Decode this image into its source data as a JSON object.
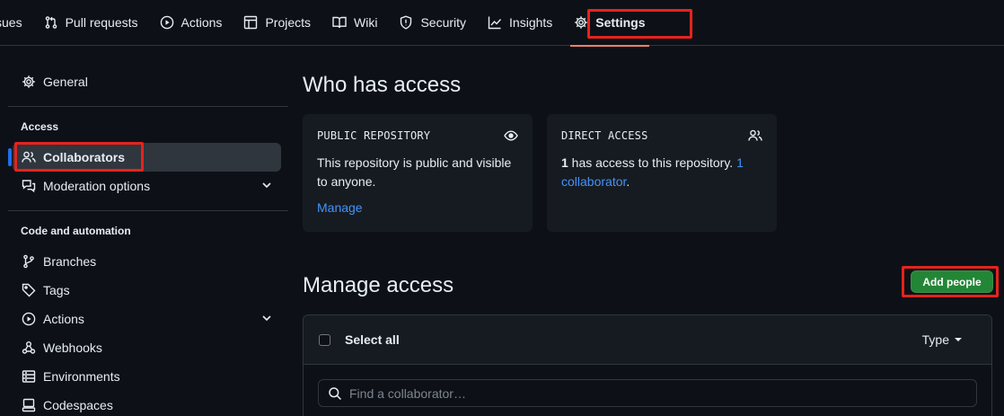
{
  "topnav": {
    "items": [
      {
        "label": "sues",
        "icon": "issue-icon"
      },
      {
        "label": "Pull requests",
        "icon": "pull-request-icon"
      },
      {
        "label": "Actions",
        "icon": "play-icon"
      },
      {
        "label": "Projects",
        "icon": "table-icon"
      },
      {
        "label": "Wiki",
        "icon": "book-icon"
      },
      {
        "label": "Security",
        "icon": "shield-icon"
      },
      {
        "label": "Insights",
        "icon": "graph-icon"
      },
      {
        "label": "Settings",
        "icon": "gear-icon",
        "selected": true
      }
    ]
  },
  "sidebar": {
    "general": "General",
    "access_heading": "Access",
    "collaborators": "Collaborators",
    "moderation": "Moderation options",
    "code_heading": "Code and automation",
    "branches": "Branches",
    "tags": "Tags",
    "actions": "Actions",
    "webhooks": "Webhooks",
    "environments": "Environments",
    "codespaces": "Codespaces"
  },
  "main": {
    "who_title": "Who has access",
    "public_card": {
      "label": "PUBLIC REPOSITORY",
      "text": "This repository is public and visible to anyone.",
      "manage": "Manage"
    },
    "direct_card": {
      "label": "DIRECT ACCESS",
      "count": "1",
      "text_mid": " has access to this repository. ",
      "link": "1 collaborator",
      "end": "."
    },
    "manage_title": "Manage access",
    "add_people": "Add people",
    "select_all": "Select all",
    "type_filter": "Type",
    "search_placeholder": "Find a collaborator…"
  },
  "colors": {
    "background": "#0d1117",
    "card": "#161b22",
    "border": "#30363d",
    "link": "#4493f8",
    "button_green": "#238636",
    "highlight_red": "#e5231d",
    "active_indicator": "#1f6feb"
  }
}
